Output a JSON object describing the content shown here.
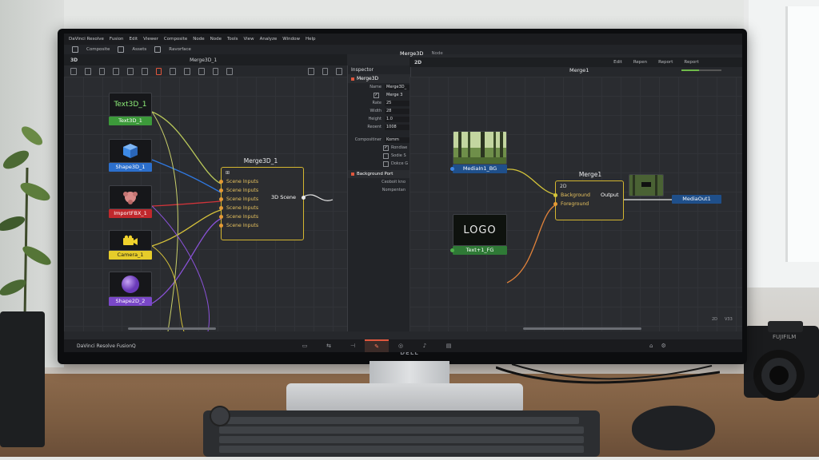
{
  "app": {
    "name": "DaVinci Resolve",
    "menus": [
      "DaVinci Resolve",
      "Fusion",
      "Edit",
      "Viewer",
      "Composite",
      "Node",
      "Node",
      "Tools",
      "View",
      "Analyze",
      "Window",
      "Help"
    ],
    "toolbar": [
      "Composite",
      "Assets",
      "Ravorface"
    ]
  },
  "left_viewer": {
    "mode": "3D",
    "title": "Merge3D_1"
  },
  "right_viewer": {
    "header": "Merge3D",
    "tab": "Node",
    "mode": "2D",
    "title": "Merge1",
    "actions": [
      "Edit",
      "Repen",
      "Report",
      "Report"
    ]
  },
  "left_nodes": {
    "text3d": {
      "thumb_text": "Text3D_1",
      "label": "Text3D_1"
    },
    "shape3d": {
      "label": "Shape3D_1"
    },
    "importfbx": {
      "label": "ImportFBX_1"
    },
    "camera": {
      "label": "Camera_1"
    },
    "shape2d": {
      "label": "Shape2D_2"
    },
    "merge3d": {
      "title": "Merge3D_1",
      "inputs": [
        "Scene Inputs",
        "Scene Inputs",
        "Scene Inputs",
        "Scene Inputs",
        "Scene Inputs",
        "Scene Inputs"
      ],
      "output": "3D Scene"
    }
  },
  "inspector": {
    "title": "Inspector",
    "section": "Merge3D",
    "fields": [
      {
        "k": "Name",
        "v": "Merge3D_"
      },
      {
        "k": "",
        "v": "Merge 3"
      },
      {
        "k": "Rate",
        "v": "25"
      },
      {
        "k": "Width",
        "v": "28"
      },
      {
        "k": "Height",
        "v": "1.0"
      },
      {
        "k": "Reoent",
        "v": "1008"
      }
    ],
    "compositing_label": "Compositiner",
    "compositing_value": "Komm",
    "checks": [
      "Rondiae",
      "Sodie S",
      "Dokce G"
    ],
    "bg_section": "Background Port",
    "bg_rows": [
      "Ceoboit kno",
      "Nompentan"
    ]
  },
  "right_nodes": {
    "media_in": {
      "label": "MediaIn1_BG"
    },
    "text_fg": {
      "thumb_text": "LOGO",
      "label": "Text+1_FG"
    },
    "merge1": {
      "title": "Merge1",
      "tag": "2D",
      "background": "Background",
      "foreground": "Foreground",
      "output": "Output"
    },
    "media_out": {
      "label": "MediaOut1"
    }
  },
  "status": {
    "left": "DaVinci Resolve FusionQ",
    "right": [
      "2D",
      "V33"
    ]
  },
  "monitor_brand": "DELL",
  "colors": {
    "accent": "#e0573d",
    "merge_yellow": "#d4b630",
    "text3d_green": "#3c9a3a",
    "shape_blue": "#2c6fcc",
    "fbx_red": "#c0282c",
    "camera_yellow": "#e6cc2a",
    "shape2d_purple": "#7a48c8"
  }
}
